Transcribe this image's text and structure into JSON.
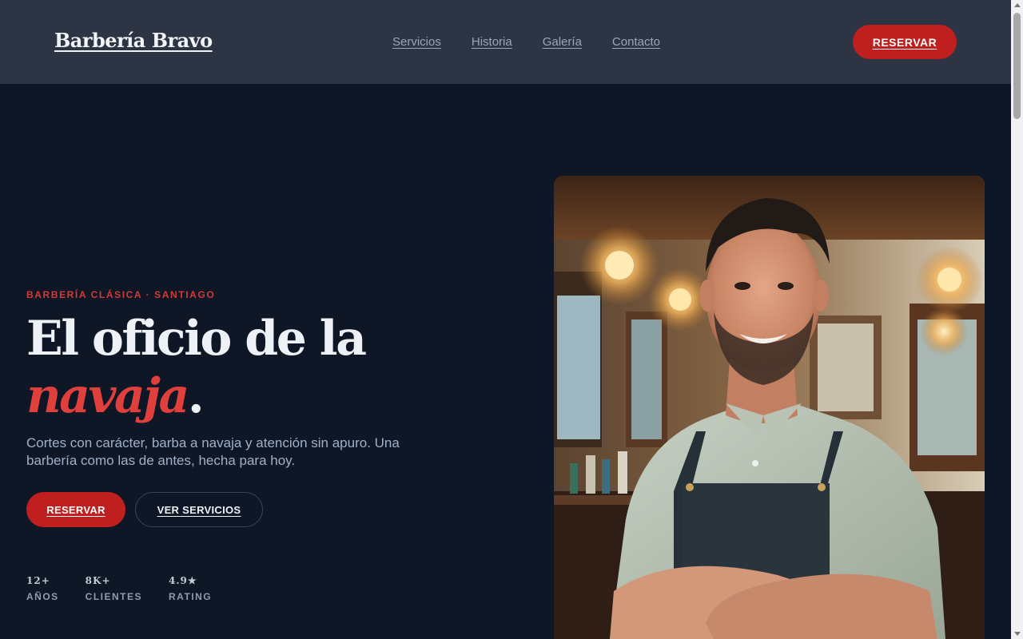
{
  "header": {
    "logo": "Barbería Bravo",
    "nav": [
      "Servicios",
      "Historia",
      "Galería",
      "Contacto"
    ],
    "cta": "RESERVAR"
  },
  "hero": {
    "eyebrow": "BARBERÍA CLÁSICA · SANTIAGO",
    "title_line1": "El oficio de la",
    "title_accent": "navaja",
    "title_end": ".",
    "description": "Cortes con carácter, barba a navaja y atención sin apuro. Una barbería como las de antes, hecha para hoy.",
    "primary_button": "RESERVAR",
    "secondary_button": "VER SERVICIOS",
    "stats": [
      {
        "value": "12+",
        "label": "AÑOS"
      },
      {
        "value": "8K+",
        "label": "CLIENTES"
      },
      {
        "value": "4.9★",
        "label": "RATING"
      }
    ]
  },
  "colors": {
    "header_bg": "#2d3444",
    "page_bg": "#0f1726",
    "accent_red": "#c01f1f",
    "accent_text": "#e0403c"
  },
  "icons": {
    "scroll_up": "chevron-up-icon",
    "scroll_down": "chevron-down-icon"
  }
}
